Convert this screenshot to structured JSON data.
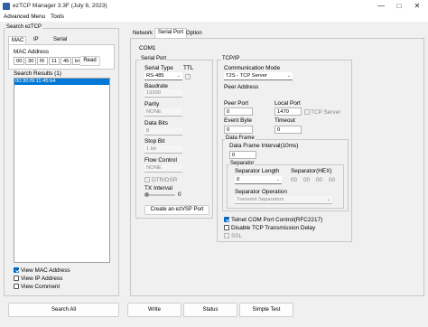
{
  "window": {
    "title": "ezTCP Manager 3.3F (July 6, 2023)",
    "minimize_icon": "minimize-icon",
    "maximize_icon": "maximize-icon",
    "close_icon": "close-icon"
  },
  "menu": [
    "Advanced Menu",
    "Tools"
  ],
  "left": {
    "group_title": "Search ezTCP",
    "tabs": [
      "MAC",
      "IP",
      "Serial"
    ],
    "mac_label": "MAC Address",
    "mac_octets": [
      "00",
      "30",
      "f9",
      "11",
      "45",
      "b4"
    ],
    "read_button": "Read",
    "results_label": "Search Results (1)",
    "results": [
      "00:30:f9:11:45:b4"
    ],
    "view_options": [
      {
        "label": "View MAC Address",
        "checked": true
      },
      {
        "label": "View IP Address",
        "checked": false
      },
      {
        "label": "View Comment",
        "checked": false
      }
    ]
  },
  "right": {
    "tabs": [
      "Network",
      "Serial Port",
      "Option"
    ],
    "active_tab": "Serial Port",
    "com_label": "COM1",
    "serial": {
      "group_title": "Serial Port",
      "serial_type_label": "Serial Type",
      "serial_type_value": "RS-485",
      "ttl_label": "TTL",
      "baudrate_label": "Baudrate",
      "baudrate_value": "19200",
      "parity_label": "Parity",
      "parity_value": "NONE",
      "databits_label": "Data Bits",
      "databits_value": "8",
      "stopbit_label": "Stop Bit",
      "stopbit_value": "1 bit",
      "flow_label": "Flow Control",
      "flow_value": "NONE",
      "dtr_label": "DTR/DSR",
      "tx_label": "TX Interval",
      "tx_value": "0",
      "vsp_button": "Create an ezVSP Port"
    },
    "tcpip": {
      "group_title": "TCP/IP",
      "comm_mode_label": "Communication Mode",
      "comm_mode_value": "T2S - TCP Server",
      "peer_address_label": "Peer Address",
      "peer_port_label": "Peer Port",
      "peer_port_value": "0",
      "local_port_label": "Local Port",
      "local_port_value": "1470",
      "tcp_server_label": "TCP Server",
      "event_byte_label": "Event Byte",
      "event_byte_value": "0",
      "timeout_label": "Timeout",
      "timeout_value": "0",
      "data_frame_title": "Data Frame",
      "data_frame_interval_label": "Data Frame Interval(10ms)",
      "data_frame_interval_value": "0",
      "separator_title": "Separator",
      "separator_length_label": "Separator Length",
      "separator_length_value": "0",
      "separator_hex_label": "Separator(HEX)",
      "separator_hex_values": [
        "00",
        "00",
        "00",
        "00"
      ],
      "separator_op_label": "Separator Operation",
      "separator_op_value": "Transmit Separators",
      "telnet_label": "Telnet COM Port Control(RFC2217)",
      "telnet_checked": true,
      "disable_tcp_label": "Disable TCP Transmission Delay",
      "ssl_label": "SSL"
    }
  },
  "bottom_buttons": [
    "Search All",
    "Write",
    "Status",
    "Simple Test"
  ],
  "colors": {
    "accent": "#0078d7",
    "background": "#f0f0f0"
  }
}
